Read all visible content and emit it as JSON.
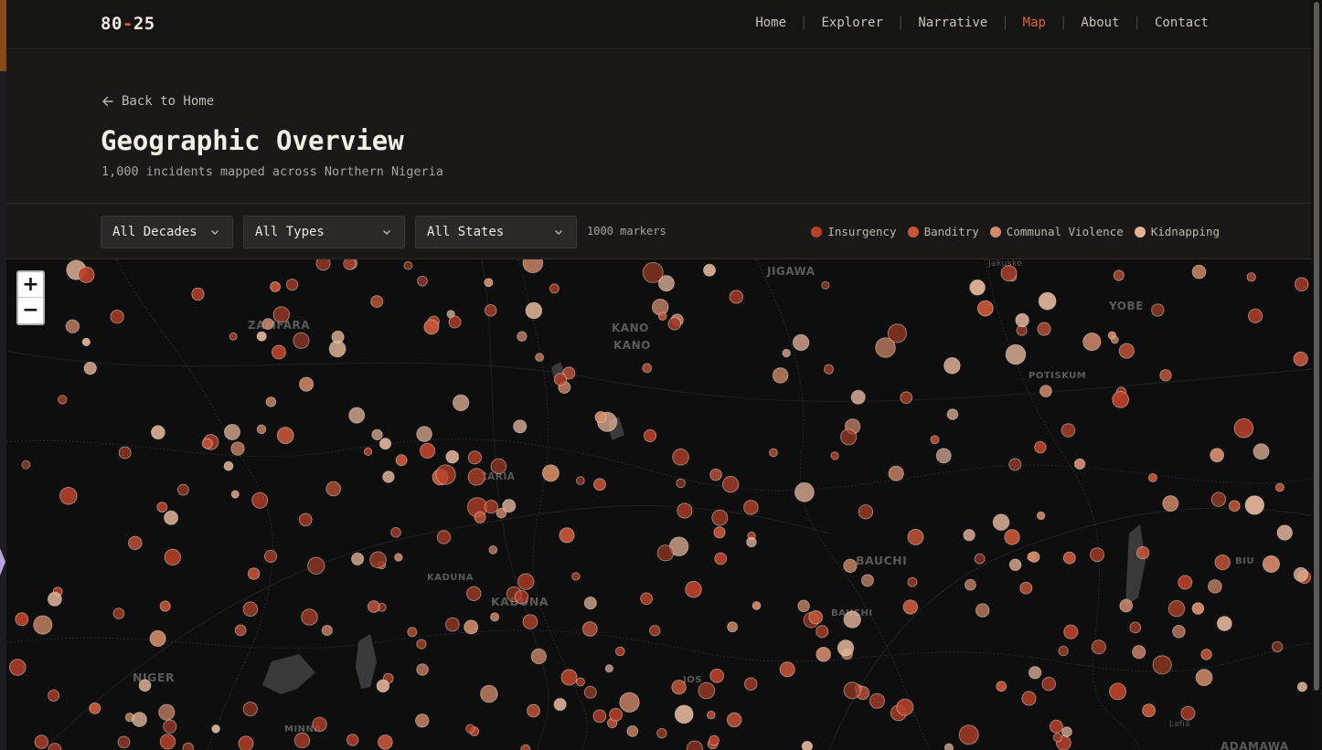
{
  "nav": {
    "logo_left": "80",
    "logo_dash": "-",
    "logo_right": "25",
    "links": [
      "Home",
      "Explorer",
      "Narrative",
      "Map",
      "About",
      "Contact"
    ],
    "active": "Map"
  },
  "hero": {
    "back_label": "Back to Home",
    "title": "Geographic Overview",
    "subtitle": "1,000 incidents mapped across Northern Nigeria"
  },
  "filters": {
    "decades": "All Decades",
    "types": "All Types",
    "states": "All States",
    "marker_count": "1000 markers"
  },
  "legend": [
    {
      "label": "Insurgency",
      "color": "#b8412a"
    },
    {
      "label": "Banditry",
      "color": "#c7563a"
    },
    {
      "label": "Communal Violence",
      "color": "#d58c6c"
    },
    {
      "label": "Kidnapping",
      "color": "#e3b49a"
    }
  ],
  "map": {
    "zoom_in": "+",
    "zoom_out": "−",
    "labels": {
      "jigawa": "JIGAWA",
      "jakusko": "Jakusko",
      "zamfara": "ZAMFARA",
      "kano_state": "KANO",
      "kano_city": "KANO",
      "yobe": "YOBE",
      "potiskum": "POTISKUM",
      "zaria": "ZARIA",
      "bauchi_state": "BAUCHI",
      "bauchi_city": "BAUCHI",
      "biu": "BIU",
      "kaduna_city": "KADUNA",
      "kaduna_state": "KADUNA",
      "niger": "NIGER",
      "jos": "JOS",
      "minna": "MINNA",
      "lafia": "Lafia",
      "adamawa": "ADAMAWA"
    }
  }
}
